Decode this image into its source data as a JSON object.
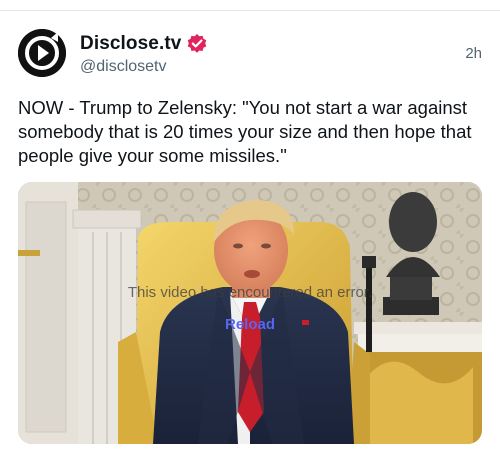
{
  "post": {
    "author": {
      "display_name": "Disclose.tv",
      "handle": "@disclosetv",
      "avatar_icon": "play-logo-icon",
      "verified_icon": "verified-badge-icon",
      "verified_color": "#e0245e"
    },
    "timestamp": "2h",
    "text": "NOW - Trump to Zelensky: \"You not start a war against somebody that is 20 times your size and then hope that people give your some missiles.\"",
    "media": {
      "error_message": "This video has encountered an error.",
      "reload_label": "Reload"
    }
  }
}
